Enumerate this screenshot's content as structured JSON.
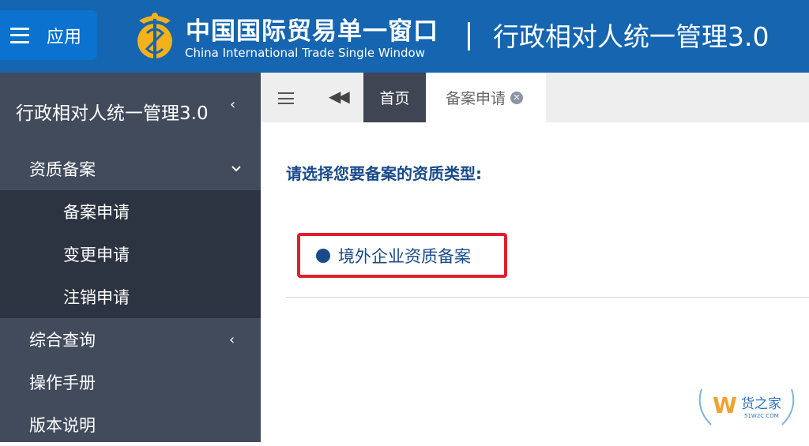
{
  "header": {
    "app_button_label": "应用",
    "brand_cn": "中国国际贸易单一窗口",
    "brand_en": "China International Trade Single Window",
    "system_title": "行政相对人统一管理3.0"
  },
  "sidebar": {
    "title": "行政相对人统一管理3.0",
    "menu": [
      {
        "label": "资质备案",
        "expanded": true,
        "children": [
          {
            "label": "备案申请"
          },
          {
            "label": "变更申请"
          },
          {
            "label": "注销申请"
          }
        ]
      },
      {
        "label": "综合查询",
        "expanded": false
      },
      {
        "label": "操作手册"
      },
      {
        "label": "版本说明"
      }
    ]
  },
  "tabs": [
    {
      "label": "首页",
      "active": false
    },
    {
      "label": "备案申请",
      "active": true,
      "closable": true
    }
  ],
  "content": {
    "prompt": "请选择您要备案的资质类型:",
    "options": [
      {
        "label": "境外企业资质备案"
      }
    ]
  },
  "watermark": {
    "main": "货之家",
    "sub": "51W2C.COM"
  },
  "colors": {
    "header_bg": "#1565b0",
    "sidebar_bg": "#424b5c",
    "submenu_bg": "#2d3441",
    "accent_text": "#1a4a8a",
    "highlight_border": "#e01f2c"
  },
  "icons": [
    "menu-icon",
    "emblem-icon",
    "chevron-left-icon",
    "chevron-down-icon",
    "double-left-icon",
    "close-circle-icon",
    "radio-dot-icon"
  ]
}
